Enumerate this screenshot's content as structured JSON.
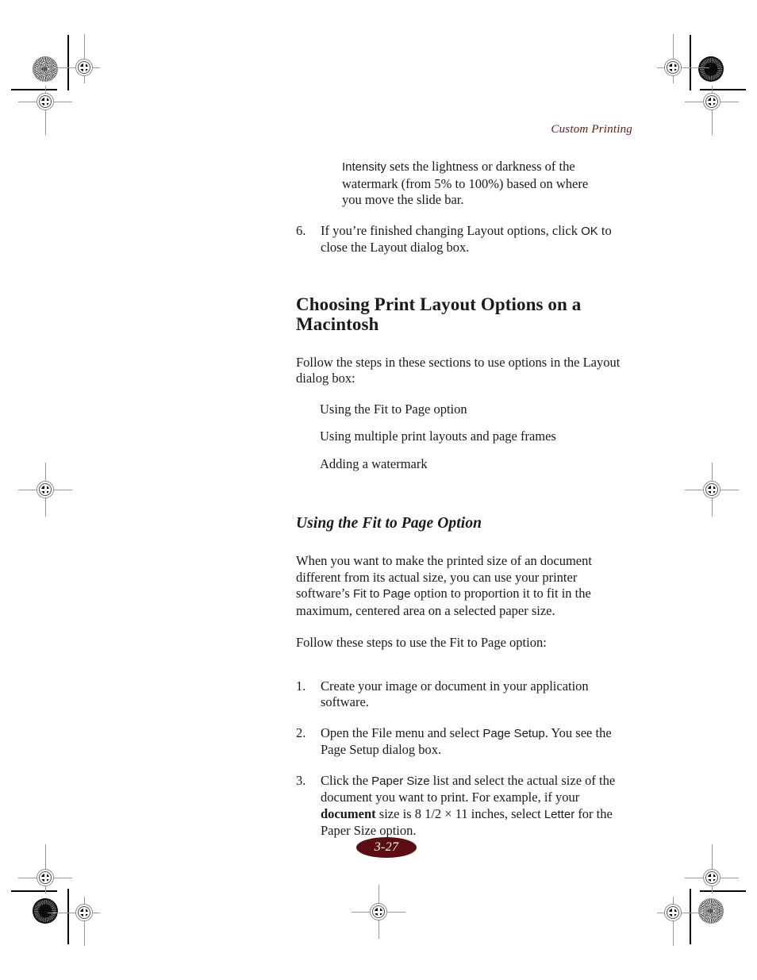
{
  "page": {
    "running_head": "Custom Printing",
    "folio": "3-27"
  },
  "note": {
    "term": "Intensity",
    "text": " sets the lightness or darkness of the watermark (from 5% to 100%) based on where you move the slide bar."
  },
  "step6": {
    "number": "6.",
    "text_before": "If you’re finished changing Layout options, click ",
    "ui_label": "OK",
    "text_after": " to close the Layout dialog box."
  },
  "section": {
    "heading": "Choosing Print Layout Options on a Macintosh",
    "intro": "Follow the steps in these sections to use options in the Layout dialog box:",
    "bullets": [
      "Using the Fit to Page option",
      "Using multiple print layouts and page frames",
      "Adding a watermark"
    ]
  },
  "subsection": {
    "heading": "Using the Fit to Page Option",
    "para1_before": "When you want to make the printed size of an document different from its actual size, you can use your printer software’s ",
    "para1_ui": "Fit to Page",
    "para1_after": " option to proportion it to fit in the maximum, centered area on a selected paper size.",
    "para2": "Follow these steps to use the Fit to Page option:"
  },
  "steps": [
    {
      "number": "1.",
      "text_before": "Create your image or document in your application software.",
      "ui_label": "",
      "text_after": ""
    },
    {
      "number": "2.",
      "text_before": "Open the File menu and select ",
      "ui_label": "Page Setup",
      "text_after": ". You see the Page Setup dialog box."
    },
    {
      "number": "3.",
      "text_before": "Click the ",
      "ui_label": "Paper Size",
      "text_mid1": " list and select the actual size of the document you want to print. For example, if your ",
      "emphasis": "document",
      "text_mid2": " size is 8 1/2 × 11 inches, select ",
      "ui_label2": "Letter",
      "text_after": " for the Paper Size option."
    }
  ],
  "colors": {
    "running_head": "#6b1515",
    "folio_background": "#5b0d12",
    "folio_text": "#ffffff",
    "body_text": "#1a1a1a"
  }
}
